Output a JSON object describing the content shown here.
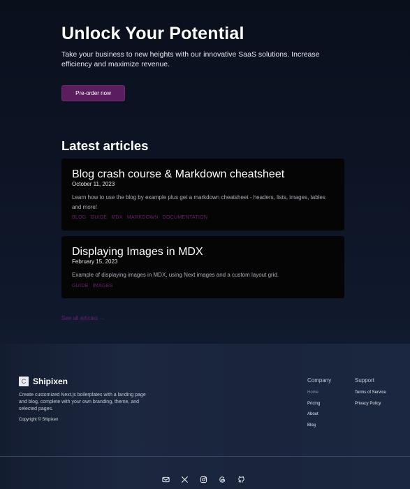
{
  "hero": {
    "title": "Unlock Your Potential",
    "subtitle": "Take your business to new heights with our innovative SaaS solutions. Increase efficiency and maximize revenue.",
    "cta_label": "Pre-order now"
  },
  "articles": {
    "heading": "Latest articles",
    "items": [
      {
        "title": "Blog crash course & Markdown cheatsheet",
        "date": "October 11, 2023",
        "summary": "Learn how to use the blog by example plus get a markdown cheatsheet - headers, lists, images, tables and more!",
        "tags": [
          "BLOG",
          "GUIDE",
          "MDX",
          "MARKDOWN",
          "DOCUMENTATION"
        ]
      },
      {
        "title": "Displaying Images in MDX",
        "date": "February 15, 2023",
        "summary": "Example of displaying images in MDX, using Next images and a custom layout grid.",
        "tags": [
          "GUIDE",
          "IMAGES"
        ]
      }
    ],
    "see_all": "See all articles →"
  },
  "footer": {
    "logo_letter": "C",
    "brand": "Shipixen",
    "description": "Create customized Next.js boilerplates with a landing page and blog, complete with your own branding, theme, and selected pages.",
    "copyright": "Copyright © Shipixen",
    "company": {
      "title": "Company",
      "links": [
        "Home",
        "Pricing",
        "About",
        "Blog"
      ]
    },
    "support": {
      "title": "Support",
      "links": [
        "Terms of Service",
        "Privacy Policy"
      ]
    },
    "socials": [
      "mail-icon",
      "x-icon",
      "instagram-icon",
      "threads-icon",
      "github-icon"
    ]
  },
  "colors": {
    "accent": "#5a1e5e",
    "tag": "#6b1f6e",
    "card_bg": "#050505"
  }
}
